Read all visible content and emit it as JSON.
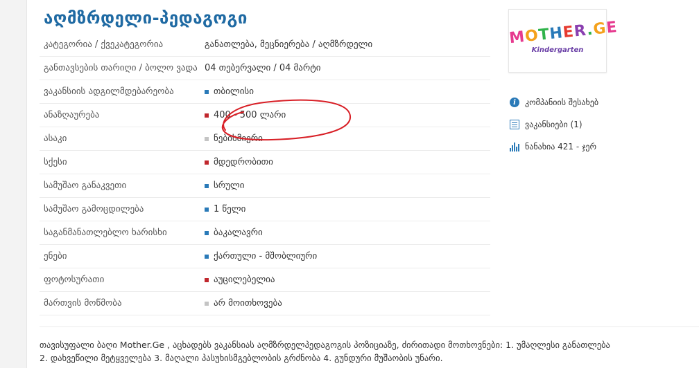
{
  "title": "აღმზრდელი-პედაგოგი",
  "rows": [
    {
      "label": "კატეგორია / ქვეკატეგორია",
      "value": "განათლება, მეცნიერება / აღმზრდელი",
      "marker": "none"
    },
    {
      "label": "განთავსების თარიღი / ბოლო ვადა",
      "value": "04 თებერვალი / 04 მარტი",
      "marker": "none"
    },
    {
      "label": "ვაკანსიის ადგილმდებარეობა",
      "value": "თბილისი",
      "marker": "blue"
    },
    {
      "label": "ანაზღაურება",
      "value": "400 - 500 ლარი",
      "marker": "red"
    },
    {
      "label": "ასაკი",
      "value": "ნებისმიერი",
      "marker": "gray"
    },
    {
      "label": "სქესი",
      "value": "მდედრობითი",
      "marker": "red"
    },
    {
      "label": "სამუშაო განაკვეთი",
      "value": "სრული",
      "marker": "blue"
    },
    {
      "label": "სამუშაო გამოცდილება",
      "value": "1 წელი",
      "marker": "blue"
    },
    {
      "label": "საგანმანათლებლო ხარისხი",
      "value": "ბაკალავრი",
      "marker": "blue"
    },
    {
      "label": "ენები",
      "value": "ქართული - მშობლიური",
      "marker": "blue"
    },
    {
      "label": "ფოტოსურათი",
      "value": "აუცილებელია",
      "marker": "red"
    },
    {
      "label": "მართვის მოწმობა",
      "value": "არ მოითხოვება",
      "marker": "gray"
    }
  ],
  "logo": {
    "brand": "MOTHER.GE",
    "sub": "Kindergarten"
  },
  "sidebar": {
    "about": "კომპანიის შესახებ",
    "vacancies": "ვაკანსიები (1)",
    "views": "ნანახია 421 - ჯერ"
  },
  "description": {
    "line1": "თავისუფალი ბაღი Mother.Ge , აცხადებს ვაკანსიას აღმზრდელპედაგოგის პოზიციაზე, ძირითადი მოთხოვნები: 1. უმაღლესი განათლება",
    "line2": "2. დახვეწილი მეტყველება 3. მაღალი პასუხისმგებლობის გრძნობა 4. გუნდური მუშაობის უნარი."
  },
  "colors": {
    "accent": "#1f6aa3",
    "marker_blue": "#2a7ab8",
    "marker_red": "#c0272d",
    "marker_gray": "#c4c4c4",
    "annotation": "#d81f26"
  }
}
